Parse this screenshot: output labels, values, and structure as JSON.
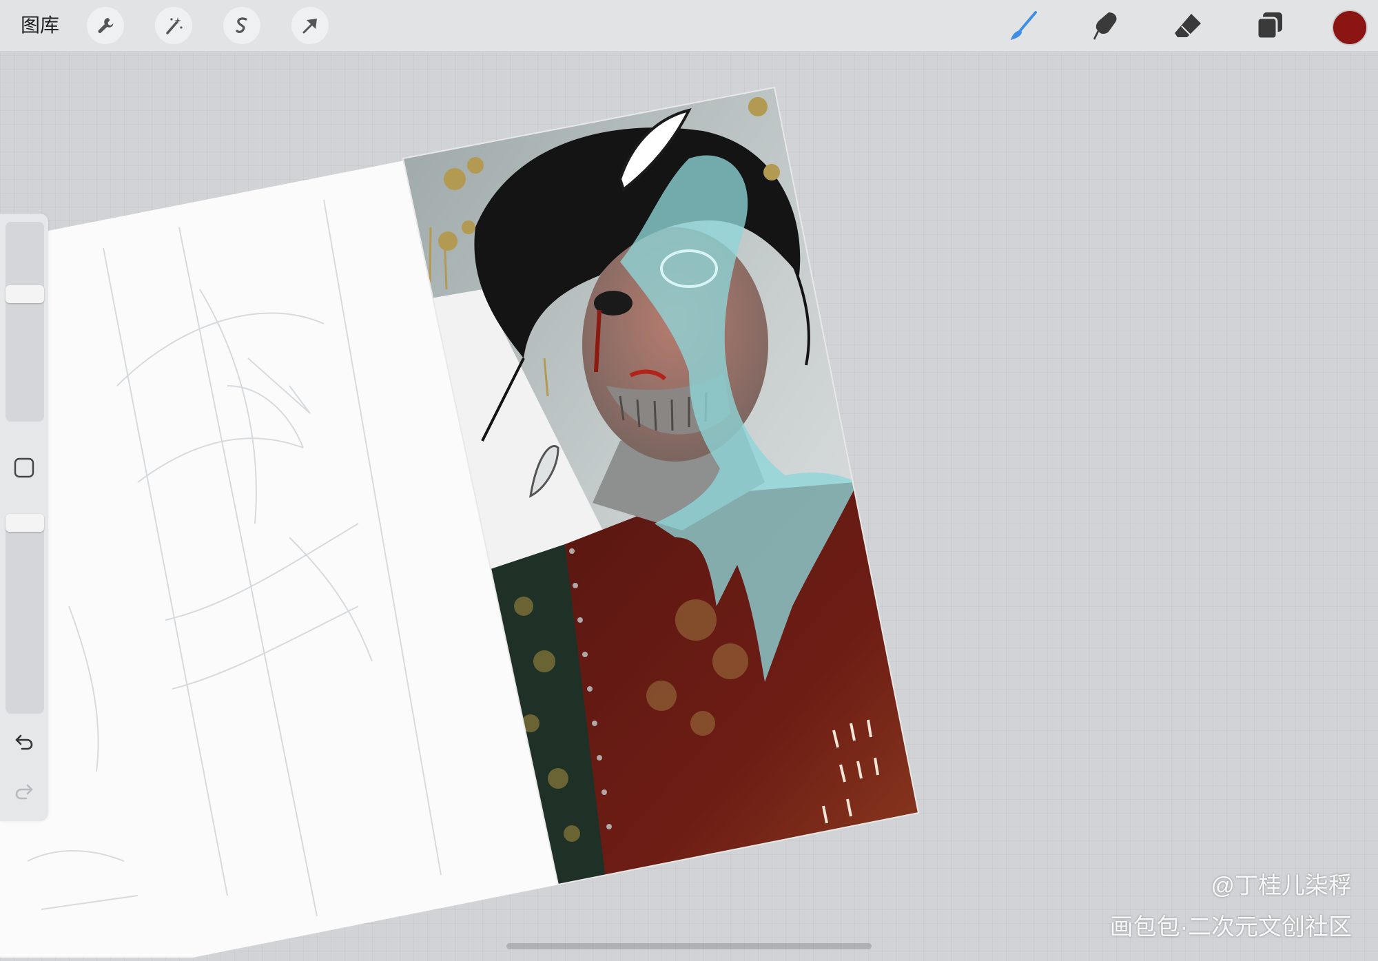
{
  "topbar": {
    "gallery_label": "图库",
    "left_tools": [
      "wrench-icon",
      "magic-wand-icon",
      "selection-icon",
      "transform-arrow-icon"
    ],
    "right_tools": [
      "brush-icon",
      "smudge-icon",
      "eraser-icon",
      "layers-icon"
    ],
    "current_color": "#8b1512",
    "brush_color": "#3f8ee6"
  },
  "sidebar": {
    "brush_size_level": 0.35,
    "opacity_level": 0.0
  },
  "watermark": {
    "line1": "@丁桂儿柒稃",
    "line2": "画包包·二次元文创社区"
  }
}
